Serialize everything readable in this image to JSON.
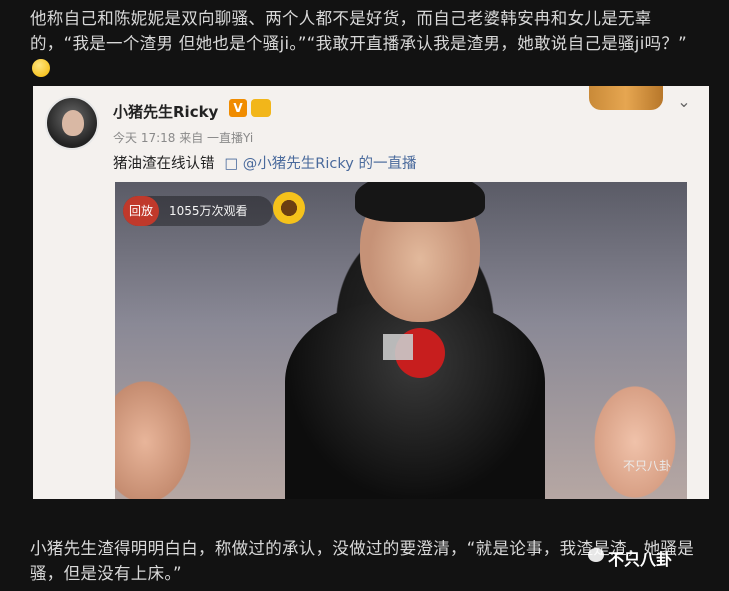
{
  "article": {
    "top_paragraph": "他称自己和陈妮妮是双向聊骚、两个人都不是好货，而自己老婆韩安冉和女儿是无辜的，“我是一个渣男 但她也是个骚ji。”“我敢开直播承认我是渣男，她敢说自己是骚ji吗？”",
    "bottom_paragraph": "小猪先生渣得明明白白，称做过的承认，没做过的要澄清，“就是论事，我渣是渣，她骚是骚，但是没有上床。”"
  },
  "post": {
    "username": "小猪先生Ricky",
    "verified_label": "V",
    "meta": "今天 17:18 来自 一直播Yi",
    "text": "猪油渣在线认错",
    "link_text": "□ @小猪先生Ricky 的一直播",
    "chevron": "⌄"
  },
  "video": {
    "replay_label": "回放",
    "views": "1055万次观看",
    "watermark": "不只八卦"
  },
  "page_watermark": {
    "text": "不只八卦"
  },
  "icons": {
    "emoji": "laughing-tears-emoji",
    "chevron": "chevron-down-icon",
    "sunflower": "sunflower-sticker"
  }
}
